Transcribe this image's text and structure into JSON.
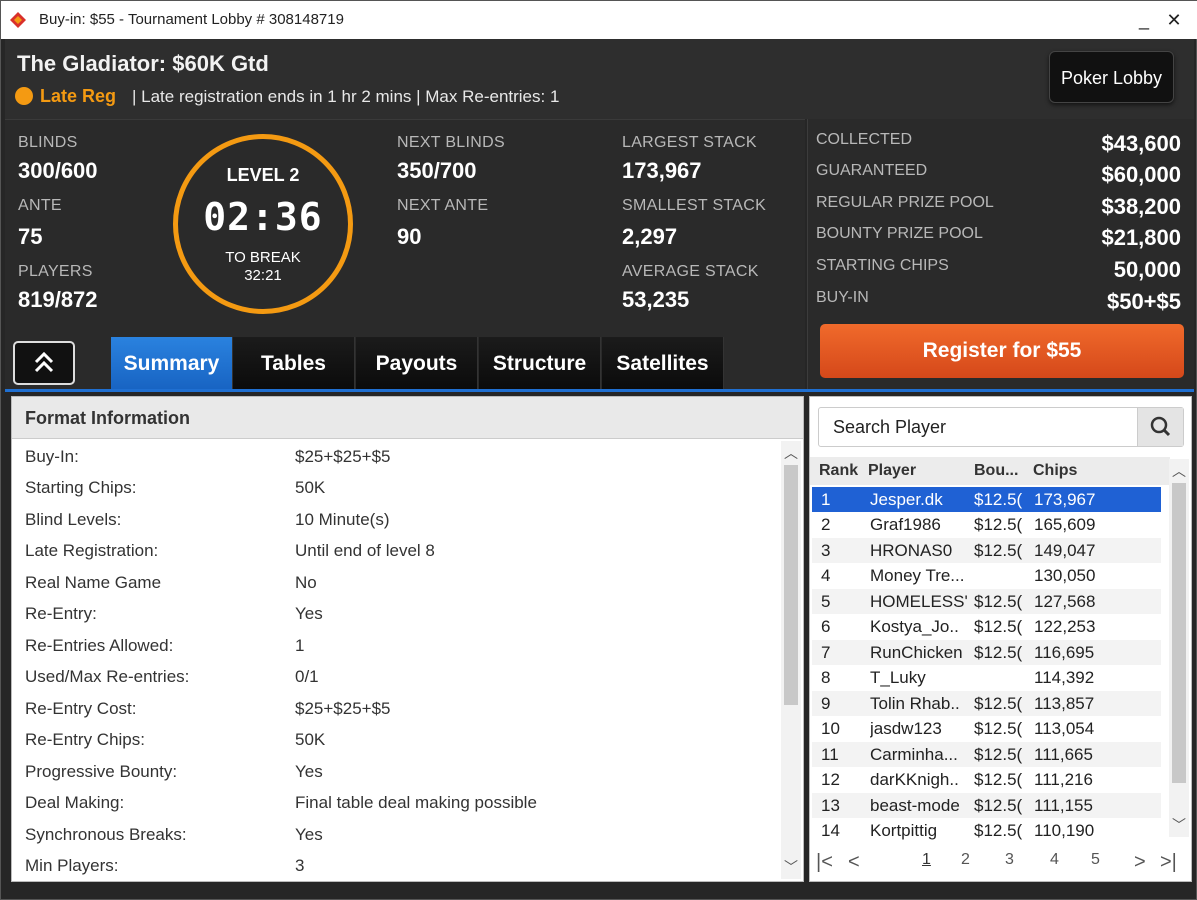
{
  "window": {
    "title": "Buy-in: $55 - Tournament Lobby # 308148719",
    "minimize": "_",
    "close": "✕"
  },
  "header": {
    "tournament_name": "The Gladiator: $60K Gtd",
    "late_reg_label": "Late Reg",
    "late_reg_info": "| Late registration ends in 1 hr  2 mins  | Max Re-entries: 1",
    "poker_lobby_button": "Poker Lobby"
  },
  "stats": {
    "blinds_label": "BLINDS",
    "blinds": "300/600",
    "ante_label": "ANTE",
    "ante": "75",
    "players_label": "PLAYERS",
    "players": "819/872",
    "level": "LEVEL 2",
    "clock": "02:36",
    "to_break_label": "TO BREAK",
    "to_break": "32:21",
    "next_blinds_label": "NEXT BLINDS",
    "next_blinds": "350/700",
    "next_ante_label": "NEXT ANTE",
    "next_ante": "90",
    "largest_stack_label": "LARGEST STACK",
    "largest_stack": "173,967",
    "smallest_stack_label": "SMALLEST STACK",
    "smallest_stack": "2,297",
    "average_stack_label": "AVERAGE STACK",
    "average_stack": "53,235"
  },
  "prize": {
    "rows": [
      {
        "label": "COLLECTED",
        "value": "$43,600"
      },
      {
        "label": "GUARANTEED",
        "value": "$60,000"
      },
      {
        "label": "REGULAR PRIZE POOL",
        "value": "$38,200"
      },
      {
        "label": "BOUNTY PRIZE POOL",
        "value": "$21,800"
      },
      {
        "label": "STARTING CHIPS",
        "value": "50,000"
      },
      {
        "label": "BUY-IN",
        "value": "$50+$5"
      }
    ],
    "register_button": "Register for  $55"
  },
  "tabs": [
    "Summary",
    "Tables",
    "Payouts",
    "Structure",
    "Satellites"
  ],
  "format": {
    "title": "Format Information",
    "rows": [
      {
        "k": "Buy-In:",
        "v": "$25+$25+$5"
      },
      {
        "k": "Starting Chips:",
        "v": "50K"
      },
      {
        "k": "Blind Levels:",
        "v": "10 Minute(s)"
      },
      {
        "k": "Late Registration:",
        "v": "Until end of level 8"
      },
      {
        "k": "Real Name Game",
        "v": "No"
      },
      {
        "k": "Re-Entry:",
        "v": "Yes"
      },
      {
        "k": "Re-Entries Allowed:",
        "v": "1"
      },
      {
        "k": "Used/Max Re-entries:",
        "v": "0/1"
      },
      {
        "k": "Re-Entry Cost:",
        "v": "$25+$25+$5"
      },
      {
        "k": "Re-Entry Chips:",
        "v": "50K"
      },
      {
        "k": "Progressive Bounty:",
        "v": "Yes"
      },
      {
        "k": "Deal Making:",
        "v": "Final table deal making possible"
      },
      {
        "k": "Synchronous Breaks:",
        "v": "Yes"
      },
      {
        "k": "Min Players:",
        "v": "3"
      }
    ]
  },
  "players": {
    "search_placeholder": "Search Player",
    "columns": [
      "Rank",
      "Player",
      "Bou...",
      "Chips"
    ],
    "rows": [
      {
        "rank": "1",
        "player": "Jesper.dk",
        "bounty": "$12.5(",
        "chips": "173,967"
      },
      {
        "rank": "2",
        "player": "Graf1986",
        "bounty": "$12.5(",
        "chips": "165,609"
      },
      {
        "rank": "3",
        "player": "HRONAS0",
        "bounty": "$12.5(",
        "chips": "149,047"
      },
      {
        "rank": "4",
        "player": "Money Tre...",
        "bounty": "",
        "chips": "130,050"
      },
      {
        "rank": "5",
        "player": "HOMELESS'",
        "bounty": "$12.5(",
        "chips": "127,568"
      },
      {
        "rank": "6",
        "player": "Kostya_Jo..",
        "bounty": "$12.5(",
        "chips": "122,253"
      },
      {
        "rank": "7",
        "player": "RunChicken",
        "bounty": "$12.5(",
        "chips": "116,695"
      },
      {
        "rank": "8",
        "player": "T_Luky",
        "bounty": "",
        "chips": "114,392"
      },
      {
        "rank": "9",
        "player": "Tolin Rhab..",
        "bounty": "$12.5(",
        "chips": "113,857"
      },
      {
        "rank": "10",
        "player": "jasdw123",
        "bounty": "$12.5(",
        "chips": "113,054"
      },
      {
        "rank": "11",
        "player": "Carminha...",
        "bounty": "$12.5(",
        "chips": "111,665"
      },
      {
        "rank": "12",
        "player": "darKKnigh..",
        "bounty": "$12.5(",
        "chips": "111,216"
      },
      {
        "rank": "13",
        "player": "beast-mode",
        "bounty": "$12.5(",
        "chips": "111,155"
      },
      {
        "rank": "14",
        "player": "Kortpittig",
        "bounty": "$12.5(",
        "chips": "110,190"
      }
    ],
    "pages": [
      "1",
      "2",
      "3",
      "4",
      "5"
    ]
  },
  "colors": {
    "accent_orange": "#f49a12",
    "register_orange": "#e5591f",
    "tab_active_blue": "#1f6fd1",
    "row_selected_blue": "#1f61d4"
  }
}
